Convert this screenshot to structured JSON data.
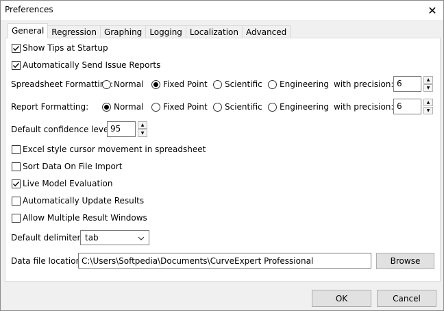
{
  "window": {
    "title": "Preferences"
  },
  "tabs": [
    {
      "label": "General",
      "active": true
    },
    {
      "label": "Regression"
    },
    {
      "label": "Graphing"
    },
    {
      "label": "Logging"
    },
    {
      "label": "Localization"
    },
    {
      "label": "Advanced"
    }
  ],
  "general": {
    "show_tips": {
      "label": "Show Tips at Startup",
      "checked": true
    },
    "send_reports": {
      "label": "Automatically Send Issue Reports",
      "checked": true
    },
    "spreadsheet_formatting": {
      "label": "Spreadsheet Formatting:",
      "options": [
        "Normal",
        "Fixed Point",
        "Scientific",
        "Engineering"
      ],
      "selected": "Fixed Point",
      "precision_label": "with precision:",
      "precision": "6"
    },
    "report_formatting": {
      "label": "Report Formatting:",
      "options": [
        "Normal",
        "Fixed Point",
        "Scientific",
        "Engineering"
      ],
      "selected": "Normal",
      "precision_label": "with precision:",
      "precision": "6"
    },
    "confidence": {
      "label": "Default confidence level:",
      "value": "95"
    },
    "excel_cursor": {
      "label": "Excel style cursor movement in spreadsheet",
      "checked": false
    },
    "sort_data": {
      "label": "Sort Data On File Import",
      "checked": false
    },
    "live_eval": {
      "label": "Live Model Evaluation",
      "checked": true
    },
    "auto_update": {
      "label": "Automatically Update Results",
      "checked": false
    },
    "multi_windows": {
      "label": "Allow Multiple Result Windows",
      "checked": false
    },
    "delimiter": {
      "label": "Default delimiter:",
      "value": "tab"
    },
    "data_location": {
      "label": "Data file location:",
      "value": "C:\\Users\\Softpedia\\Documents\\CurveExpert Professional",
      "browse_label": "Browse"
    }
  },
  "footer": {
    "ok_label": "OK",
    "cancel_label": "Cancel"
  }
}
